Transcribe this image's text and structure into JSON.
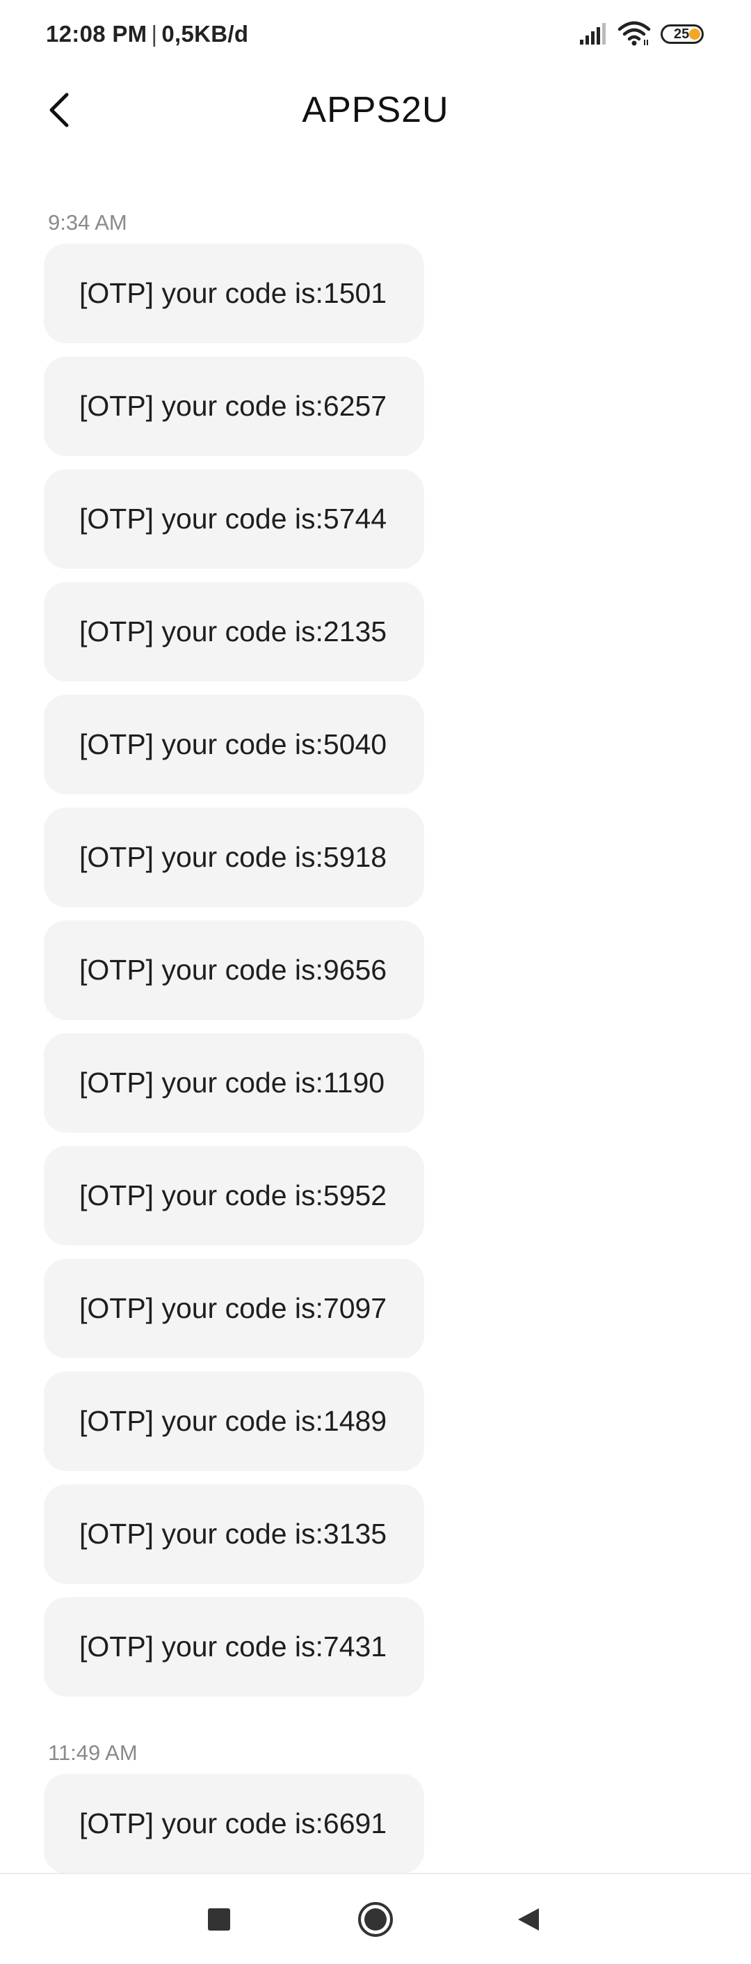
{
  "status_bar": {
    "time": "12:08 PM",
    "separator": "|",
    "network_speed": "0,5KB/d",
    "battery_level": "25",
    "icons": [
      "signal-icon",
      "wifi-icon",
      "battery-icon"
    ],
    "battery_accent": "#f5a623"
  },
  "header": {
    "title": "APPS2U",
    "back_icon": "back-arrow-icon"
  },
  "thread": {
    "groups": [
      {
        "timestamp": "9:34 AM",
        "messages": [
          "[OTP] your code is:1501",
          "[OTP] your code is:6257",
          "[OTP] your code is:5744",
          "[OTP] your code is:2135",
          "[OTP] your code is:5040",
          "[OTP] your code is:5918",
          "[OTP] your code is:9656",
          "[OTP] your code is:1190",
          "[OTP] your code is:5952",
          "[OTP] your code is:7097",
          "[OTP] your code is:1489",
          "[OTP] your code is:3135",
          "[OTP] your code is:7431"
        ]
      },
      {
        "timestamp": "11:49 AM",
        "messages": [
          "[OTP] your code is:6691"
        ]
      }
    ]
  },
  "nav_bar": {
    "icons": [
      "recents-square-icon",
      "home-circle-icon",
      "back-triangle-icon"
    ]
  },
  "colors": {
    "bubble_bg": "#f4f4f4",
    "timestamp": "#8a8a8a",
    "text": "#1e1e1e"
  }
}
